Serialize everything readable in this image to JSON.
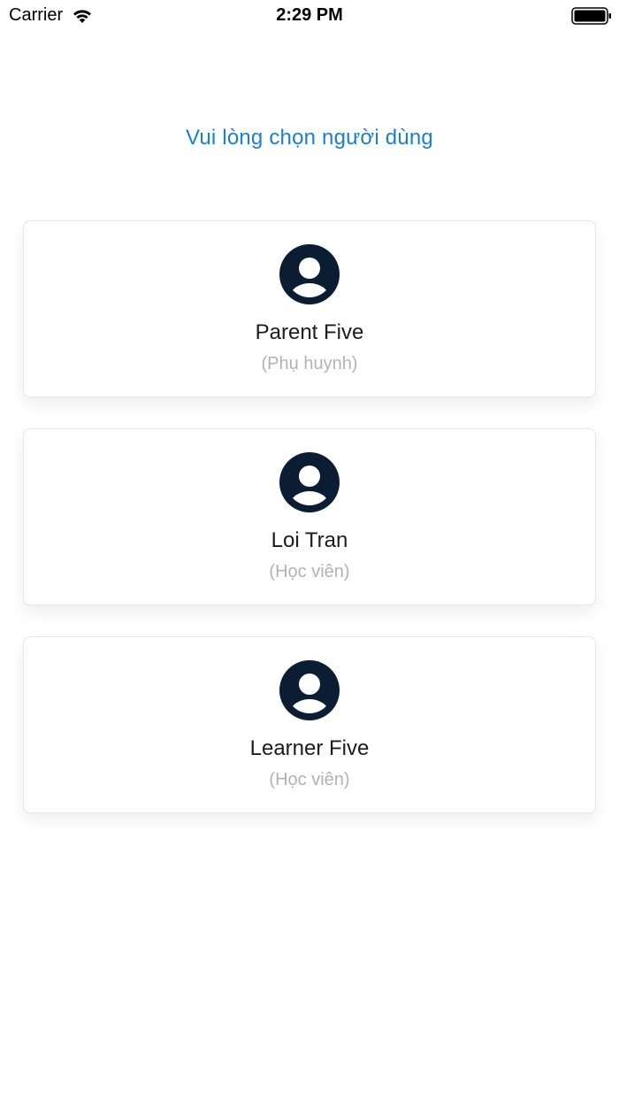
{
  "status_bar": {
    "carrier": "Carrier",
    "time": "2:29 PM"
  },
  "prompt": "Vui lòng chọn người dùng",
  "colors": {
    "accent": "#1a7fd4",
    "avatar": "#0b1d33",
    "role_text": "#b3b3b3"
  },
  "users": [
    {
      "name": "Parent Five",
      "role": "(Phụ huynh)",
      "icon": "user-avatar-icon"
    },
    {
      "name": "Loi Tran",
      "role": "(Học viên)",
      "icon": "user-avatar-icon"
    },
    {
      "name": "Learner Five",
      "role": "(Học viên)",
      "icon": "user-avatar-icon"
    }
  ]
}
